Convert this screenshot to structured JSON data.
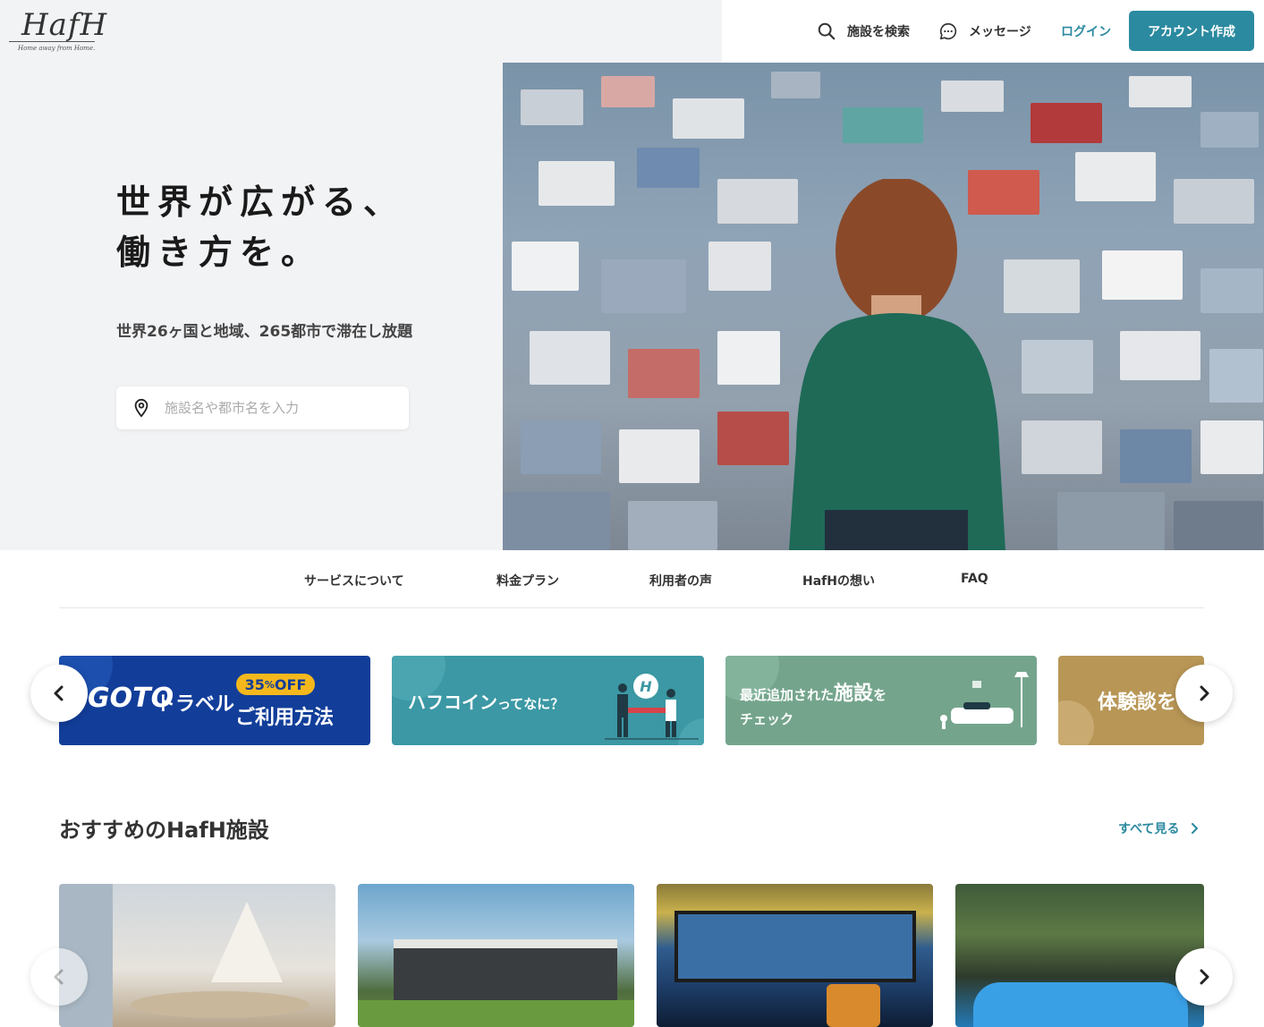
{
  "header": {
    "logo_text": "HafH",
    "logo_tagline": "Home away from Home.",
    "search_label": "施設を検索",
    "message_label": "メッセージ",
    "login_label": "ログイン",
    "signup_label": "アカウント作成",
    "accent_color": "#2b8aa0"
  },
  "hero": {
    "title_line1": "世界が広がる、",
    "title_line2": "働き方を。",
    "subtitle": "世界26ヶ国と地域、265都市で滞在し放題",
    "search_placeholder": "施設名や都市名を入力",
    "search_icon": "map-pin-icon"
  },
  "subnav": {
    "items": [
      "サービスについて",
      "料金プラン",
      "利用者の声",
      "HafHの想い",
      "FAQ"
    ]
  },
  "banners": {
    "goto": {
      "logo": "GOTO",
      "logo_sub": "トラベル",
      "badge_num": "35",
      "badge_unit": "%",
      "badge_off": "OFF",
      "text": "ご利用方法"
    },
    "coin": {
      "text_main": "ハフコイン",
      "text_small": "ってなに？",
      "icon_letter": "H"
    },
    "new": {
      "prefix": "最近追加された",
      "highlight": "施設",
      "suffix": "を",
      "line2": "チェック"
    },
    "exp": {
      "text": "体験談を"
    }
  },
  "recommended": {
    "title": "おすすめのHafH施設",
    "see_all": "すべて見る"
  }
}
